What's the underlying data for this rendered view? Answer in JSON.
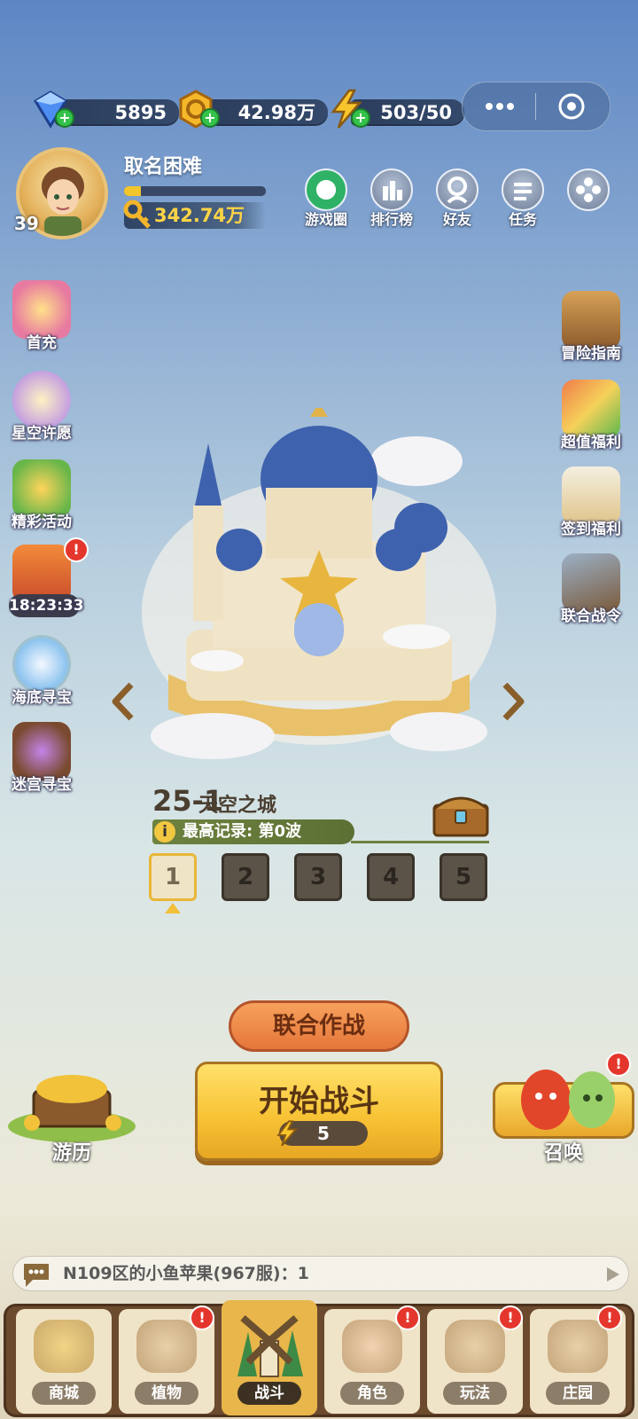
{
  "resources": {
    "gems": "5895",
    "coins": "42.98万",
    "energy": "503/50"
  },
  "profile": {
    "name": "取名困难",
    "level": "39",
    "gold": "342.74万",
    "xp_fraction": 0.12
  },
  "top_nav": [
    {
      "label": "游戏圈"
    },
    {
      "label": "排行榜"
    },
    {
      "label": "好友"
    },
    {
      "label": "任务"
    }
  ],
  "left_events": [
    {
      "label": "首充"
    },
    {
      "label": "星空许愿"
    },
    {
      "label": "精彩活动"
    },
    {
      "label": "18:23:33"
    },
    {
      "label": "海底寻宝"
    },
    {
      "label": "迷宫寻宝"
    }
  ],
  "right_events": [
    {
      "label": "冒险指南"
    },
    {
      "label": "超值福利"
    },
    {
      "label": "签到福利"
    },
    {
      "label": "联合战令"
    }
  ],
  "stage": {
    "number": "25-1",
    "name": "天空之城",
    "record": "最高记录: 第0波",
    "levels": [
      "1",
      "2",
      "3",
      "4",
      "5"
    ],
    "selected": "1"
  },
  "buttons": {
    "coop": "联合作战",
    "start": "开始战斗",
    "start_cost": "5",
    "travel": "游历",
    "summon": "召唤"
  },
  "chat": {
    "message": "N109区的小鱼苹果(967服)：1"
  },
  "bottom_tabs": [
    {
      "label": "商城"
    },
    {
      "label": "植物"
    },
    {
      "label": "战斗"
    },
    {
      "label": "角色"
    },
    {
      "label": "玩法"
    },
    {
      "label": "庄园"
    }
  ],
  "badge_text": "!",
  "colors": {
    "accent": "#f8c436",
    "badge": "#e4362c",
    "panel": "#2b3d5c"
  }
}
